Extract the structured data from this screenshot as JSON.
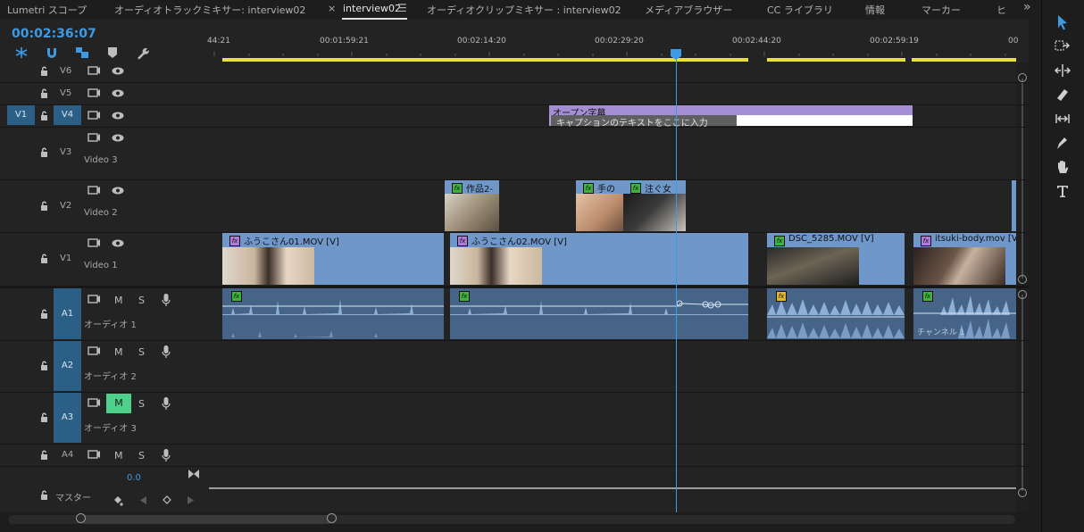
{
  "tabs": [
    {
      "label": "Lumetri スコープ"
    },
    {
      "label": "オーディオトラックミキサー: interview02"
    },
    {
      "label": "interview02"
    },
    {
      "label": "オーディオクリップミキサー : interview02"
    },
    {
      "label": "メディアブラウザー"
    },
    {
      "label": "CC ライブラリ"
    },
    {
      "label": "情報"
    },
    {
      "label": "マーカー"
    },
    {
      "label": "ヒ"
    }
  ],
  "close_glyph": "×",
  "menu_glyph": "☰",
  "overflow_glyph": "»",
  "timecode": "00:02:36:07",
  "ruler": {
    "labels": [
      "44:21",
      "00:01:59:21",
      "00:02:14:20",
      "00:02:29:20",
      "00:02:44:20",
      "00:02:59:19",
      "00"
    ]
  },
  "tracks": {
    "V6": {
      "label": "V6"
    },
    "V5": {
      "label": "V5"
    },
    "V4": {
      "label": "V4",
      "source": "V1"
    },
    "V3": {
      "label": "V3",
      "name": "Video 3"
    },
    "V2": {
      "label": "V2",
      "name": "Video 2"
    },
    "V1": {
      "label": "V1",
      "name": "Video 1"
    },
    "A1": {
      "label": "A1",
      "name": "オーディオ 1"
    },
    "A2": {
      "label": "A2",
      "name": "オーディオ 2"
    },
    "A3": {
      "label": "A3",
      "name": "オーディオ 3"
    },
    "A4": {
      "label": "A4"
    },
    "master": {
      "name": "マスター",
      "level": "0.0"
    }
  },
  "track_buttons": {
    "mute": "M",
    "solo": "S"
  },
  "clips": {
    "caption": {
      "title": "オープン字幕",
      "text": "キャプションのテキストをここに入力"
    },
    "v2": [
      "作品2-",
      "手の",
      "注ぐ女"
    ],
    "v1": [
      "ふうこさん01.MOV [V]",
      "ふうこさん02.MOV [V]",
      "DSC_5285.MOV [V]",
      "itsuki-body.mov [V]"
    ],
    "a1_channel": "チャンネル 1"
  },
  "fx_glyph": "fx",
  "colors": {
    "accent": "#3d9be6",
    "clip_video": "#6f97c9",
    "clip_audio": "#466488",
    "caption": "#b49be0",
    "mute_on": "#4fd18b",
    "ruler_work_area": "#e6e03a",
    "track_target": "#2b5f86"
  }
}
